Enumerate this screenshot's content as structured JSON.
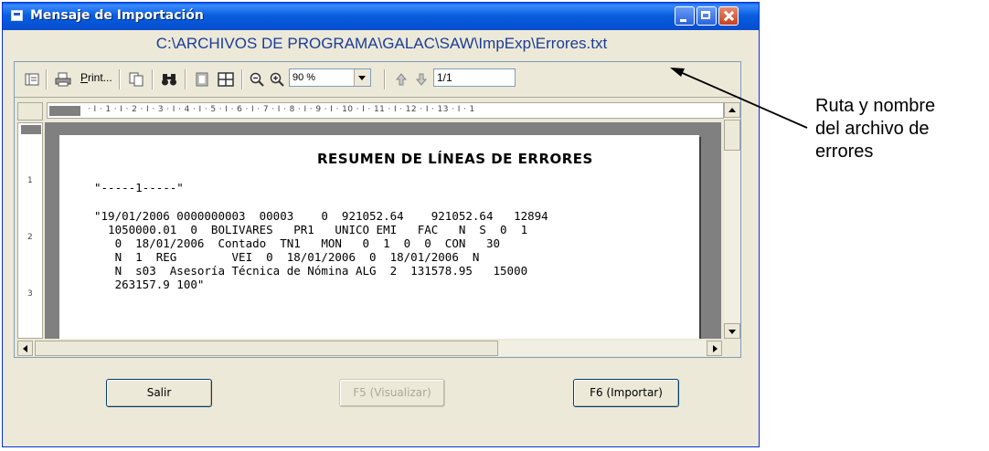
{
  "window": {
    "title": "Mensaje de Importación",
    "file_path": "C:\\ARCHIVOS DE PROGRAMA\\GALAC\\SAW\\ImpExp\\Errores.txt"
  },
  "toolbar": {
    "print_label_underlined": "P",
    "print_label_rest": "rint...",
    "zoom_value": "90 %",
    "page_value": "1/1"
  },
  "ruler": {
    "horizontal_ticks": "· I · 1 · I · 2 · I · 3 · I · 4 · I · 5 · I · 6 · I · 7 · I · 8 · I · 9 · I · 10 · I · 11 · I · 12 · I · 13 · I · 1",
    "vertical_numbers": [
      "1",
      "2",
      "3"
    ]
  },
  "document": {
    "heading": "RESUMEN DE LÍNEAS DE ERRORES",
    "lines": [
      "\"-----1-----\"",
      "\"19/01/2006 0000000003  00003    0  921052.64    921052.64   12894",
      "  1050000.01  0  BOLIVARES   PR1   UNICO EMI   FAC   N  S  0  1",
      "   0  18/01/2006  Contado  TN1   MON   0  1  0  0  CON   30",
      "   N  1  REG        VEI  0  18/01/2006  0  18/01/2006  N",
      "   N  s03  Asesoría Técnica de Nómina ALG  2  131578.95   15000",
      "   263157.9 100\""
    ]
  },
  "buttons": {
    "salir": "Salir",
    "visualizar": "F5 (Visualizar)",
    "importar": "F6 (Importar)"
  },
  "annotation": {
    "line1": "Ruta y nombre",
    "line2": "del archivo de",
    "line3": "errores"
  },
  "colors": {
    "titlebar": "#0a5fde",
    "path_text": "#1c3d94",
    "window_bg": "#ece9d8"
  }
}
